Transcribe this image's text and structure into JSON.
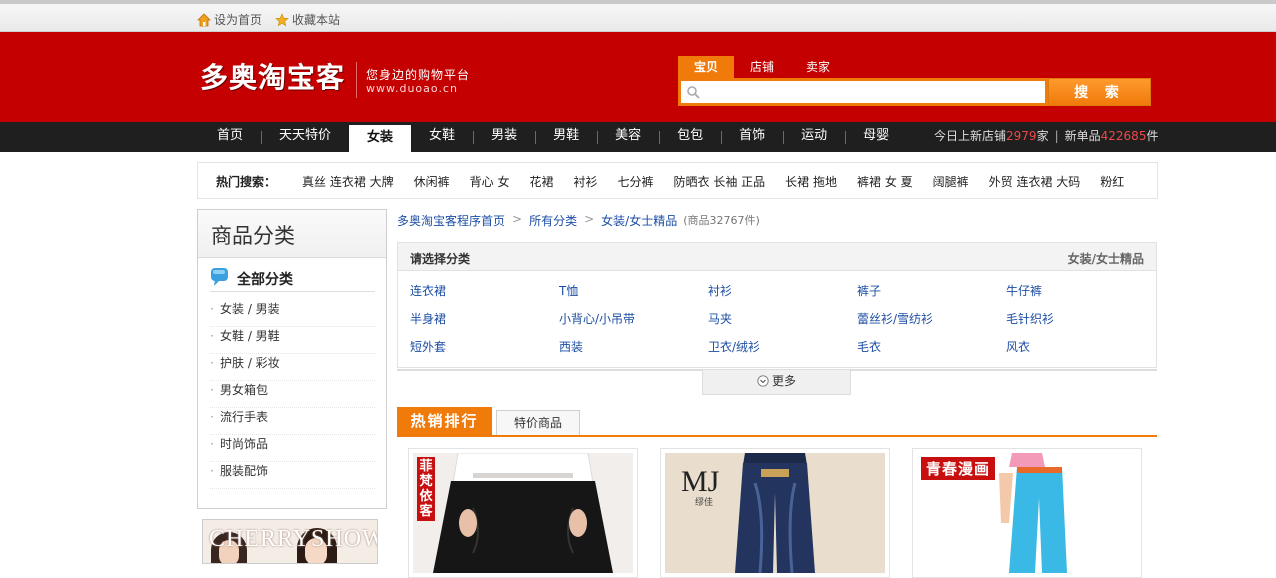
{
  "topbar": {
    "set_home": "设为首页",
    "bookmark": "收藏本站"
  },
  "header": {
    "logo": "多奥淘宝客",
    "slogan": "您身边的购物平台",
    "url": "www.duoao.cn",
    "search_tabs": [
      "宝贝",
      "店铺",
      "卖家"
    ],
    "search_button": "搜 索",
    "search_value": ""
  },
  "nav": {
    "items": [
      "首页",
      "天天特价",
      "女装",
      "女鞋",
      "男装",
      "男鞋",
      "美容",
      "包包",
      "首饰",
      "运动",
      "母婴"
    ],
    "active": "女装",
    "stats": {
      "new_shops_label": "今日上新店铺",
      "new_shops": "2979",
      "shops_unit": "家",
      "new_items_label": "新单品",
      "new_items": "422685",
      "items_unit": "件"
    }
  },
  "hot_search": {
    "label": "热门搜索：",
    "words": [
      "真丝 连衣裙 大牌",
      "休闲裤",
      "背心 女",
      "花裙",
      "衬衫",
      "七分裤",
      "防晒衣 长袖 正品",
      "长裙 拖地",
      "裤裙 女 夏",
      "阔腿裤",
      "外贸 连衣裙 大码",
      "粉红"
    ]
  },
  "sidebar": {
    "title": "商品分类",
    "all": "全部分类",
    "items": [
      "女装 / 男装",
      "女鞋 / 男鞋",
      "护肤 / 彩妆",
      "男女箱包",
      "流行手表",
      "时尚饰品",
      "服装配饰"
    ]
  },
  "promo": {
    "text": "CHERRYSHOW"
  },
  "breadcrumb": {
    "items": [
      "多奥淘宝客程序首页",
      "所有分类",
      "女装/女士精品"
    ],
    "count": "(商品32767件)"
  },
  "category_panel": {
    "title": "请选择分类",
    "current": "女装/女士精品",
    "items": [
      "连衣裙",
      "T恤",
      "衬衫",
      "裤子",
      "牛仔裤",
      "半身裙",
      "小背心/小吊带",
      "马夹",
      "蕾丝衫/雪纺衫",
      "毛针织衫",
      "短外套",
      "西装",
      "卫衣/绒衫",
      "毛衣",
      "风衣"
    ],
    "more": "更多"
  },
  "product_tabs": {
    "hot": "热销排行",
    "special": "特价商品"
  },
  "products": [
    {
      "tag": "菲梵依客"
    },
    {
      "brand": "MJ",
      "brand_sub": "缪佳"
    },
    {
      "tag": "青春漫画"
    }
  ],
  "colors": {
    "brand_red": "#c40000",
    "accent_orange": "#f07a0a",
    "nav_dark": "#1f1f1f",
    "link_blue": "#1c4ea4"
  }
}
